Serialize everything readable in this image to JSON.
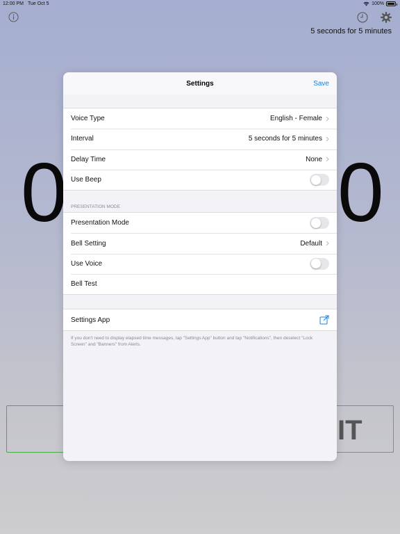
{
  "status_bar": {
    "time": "12:00 PM",
    "date": "Tue Oct 5",
    "battery": "100%"
  },
  "background": {
    "interval_label": "5 seconds for 5 minutes",
    "digit_left": "0",
    "digit_right": "0",
    "start_partial": "IT"
  },
  "modal": {
    "title": "Settings",
    "save_label": "Save",
    "group1": [
      {
        "label": "Voice Type",
        "value": "English - Female"
      },
      {
        "label": "Interval",
        "value": "5 seconds for 5 minutes"
      },
      {
        "label": "Delay Time",
        "value": "None"
      },
      {
        "label": "Use Beep",
        "toggle": false
      }
    ],
    "section_header": "PRESENTATION MODE",
    "group2": [
      {
        "label": "Presentation Mode",
        "toggle": false
      },
      {
        "label": "Bell Setting",
        "value": "Default"
      },
      {
        "label": "Use Voice",
        "toggle": false
      },
      {
        "label": "Bell Test"
      }
    ],
    "settings_app_label": "Settings App",
    "footer": "If you don't need to display elapsed time messages, tap \"Settings App\" button and tap \"Notifications\", then deselect \"Lock Screen\" and \"Banners\" from Alerts."
  },
  "colors": {
    "accent": "#1a7de0",
    "start_border": "#4ca84c"
  },
  "icons": [
    "info-icon",
    "clock-icon",
    "gear-icon",
    "chevron-right-icon",
    "external-link-icon",
    "wifi-icon",
    "battery-icon"
  ]
}
